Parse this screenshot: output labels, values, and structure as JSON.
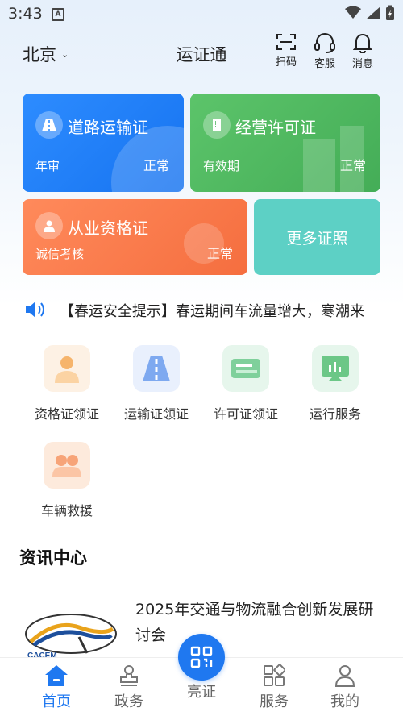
{
  "status": {
    "time": "3:43"
  },
  "header": {
    "city": "北京",
    "title": "运证通",
    "scan": "扫码",
    "service": "客服",
    "message": "消息"
  },
  "cards": {
    "road": {
      "title": "道路运输证",
      "sub": "年审",
      "status": "正常"
    },
    "license": {
      "title": "经营许可证",
      "sub": "有效期",
      "status": "正常"
    },
    "qual": {
      "title": "从业资格证",
      "sub": "诚信考核",
      "status": "正常"
    },
    "more": {
      "title": "更多证照"
    }
  },
  "notice": {
    "text": "【春运安全提示】春运期间车流量增大，寒潮来"
  },
  "services": [
    {
      "label": "资格证领证",
      "icon": "person-icon"
    },
    {
      "label": "运输证领证",
      "icon": "road-icon"
    },
    {
      "label": "许可证领证",
      "icon": "license-icon"
    },
    {
      "label": "运行服务",
      "icon": "chart-icon"
    },
    {
      "label": "车辆救援",
      "icon": "rescue-icon"
    }
  ],
  "news": {
    "section_title": "资讯中心",
    "item_title": "2025年交通与物流融合创新发展研讨会",
    "logo_text": "CACEM"
  },
  "tabs": {
    "home": "首页",
    "gov": "政务",
    "show": "亮证",
    "service": "服务",
    "mine": "我的"
  },
  "colors": {
    "accent": "#1f78f0",
    "blue_card": "#1673f0",
    "green_card": "#44ad57",
    "orange_card": "#f56e3f",
    "teal_card": "#5dd0c5"
  }
}
